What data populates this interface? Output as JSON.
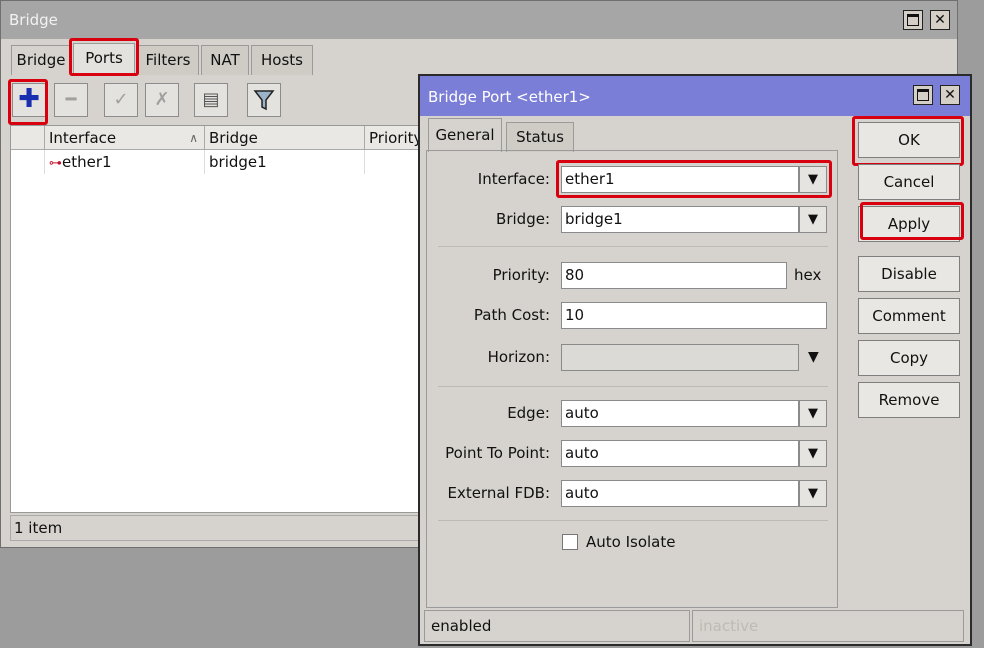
{
  "bridge_window": {
    "title": "Bridge",
    "tabs": [
      "Bridge",
      "Ports",
      "Filters",
      "NAT",
      "Hosts"
    ],
    "toolbar_icons": [
      "add-icon",
      "remove-icon",
      "enable-icon",
      "disable-icon",
      "comment-icon",
      "filter-icon"
    ],
    "columns": [
      "Interface",
      "Bridge",
      "Priority"
    ],
    "rows": [
      {
        "interface": "ether1",
        "bridge": "bridge1"
      }
    ],
    "status": "1 item"
  },
  "dialog": {
    "title": "Bridge Port <ether1>",
    "tabs": [
      "General",
      "Status"
    ],
    "fields": {
      "interface_label": "Interface:",
      "interface_value": "ether1",
      "bridge_label": "Bridge:",
      "bridge_value": "bridge1",
      "priority_label": "Priority:",
      "priority_value": "80",
      "priority_unit": "hex",
      "path_cost_label": "Path Cost:",
      "path_cost_value": "10",
      "horizon_label": "Horizon:",
      "horizon_value": "",
      "edge_label": "Edge:",
      "edge_value": "auto",
      "p2p_label": "Point To Point:",
      "p2p_value": "auto",
      "ext_fdb_label": "External FDB:",
      "ext_fdb_value": "auto",
      "auto_isolate_label": "Auto Isolate"
    },
    "buttons": [
      "OK",
      "Cancel",
      "Apply",
      "Disable",
      "Comment",
      "Copy",
      "Remove"
    ],
    "status_left": "enabled",
    "status_right": "inactive"
  },
  "highlight_color": "#d8000f",
  "title_color": "#7b7ed6"
}
